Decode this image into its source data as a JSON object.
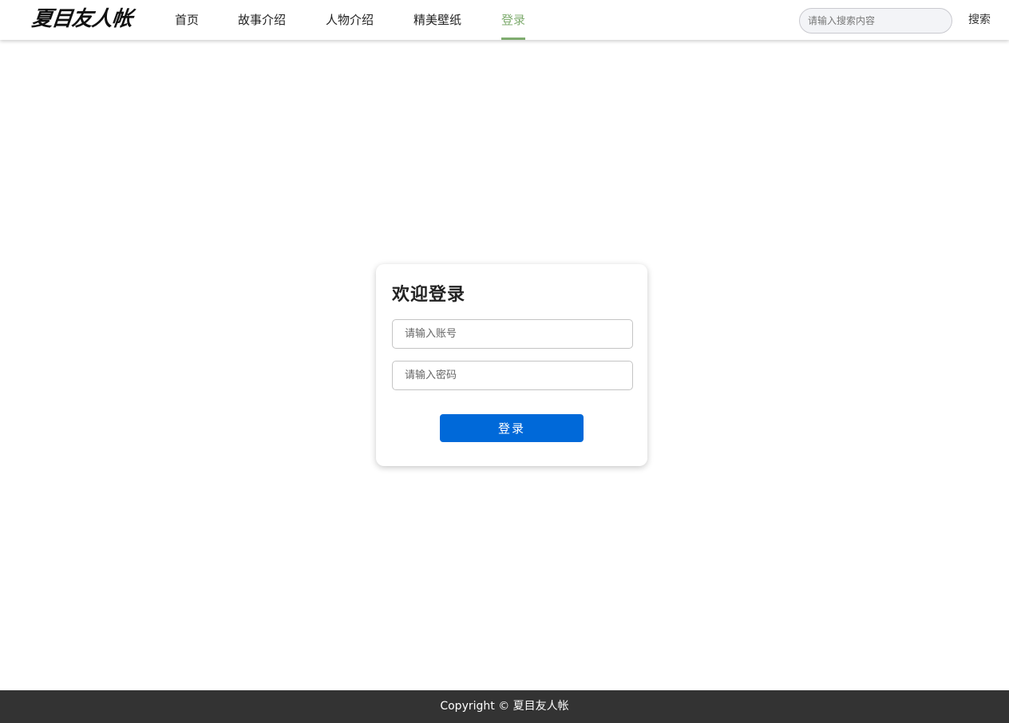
{
  "header": {
    "logo_text": "夏目友人帐",
    "nav": [
      {
        "label": "首页",
        "active": false
      },
      {
        "label": "故事介绍",
        "active": false
      },
      {
        "label": "人物介绍",
        "active": false
      },
      {
        "label": "精美壁纸",
        "active": false
      },
      {
        "label": "登录",
        "active": true
      }
    ],
    "search_placeholder": "请输入搜索内容",
    "search_button": "搜索"
  },
  "login": {
    "title": "欢迎登录",
    "account_placeholder": "请输入账号",
    "password_placeholder": "请输入密码",
    "submit_label": "登录"
  },
  "footer": {
    "copyright": "Copyright © 夏目友人帐"
  },
  "colors": {
    "accent_green": "#7fac6f",
    "primary_button": "#0069d9",
    "footer_bg": "#333333"
  }
}
